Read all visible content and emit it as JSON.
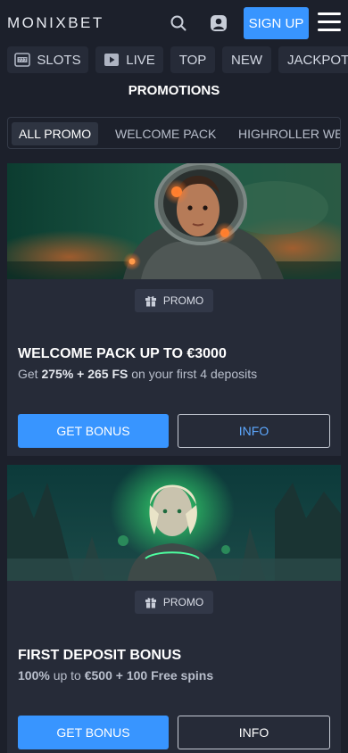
{
  "header": {
    "logo": "MONIXBET",
    "signup_label": "SIGN UP"
  },
  "nav": {
    "items": [
      {
        "label": "SLOTS",
        "icon": "slot-machine-icon"
      },
      {
        "label": "LIVE",
        "icon": "play-icon"
      },
      {
        "label": "TOP"
      },
      {
        "label": "NEW"
      },
      {
        "label": "JACKPOT"
      }
    ]
  },
  "page": {
    "title": "PROMOTIONS"
  },
  "tabs": [
    {
      "label": "ALL PROMO",
      "active": true
    },
    {
      "label": "WELCOME PACK"
    },
    {
      "label": "HIGHROLLER WE"
    }
  ],
  "promos": [
    {
      "badge": "PROMO",
      "title": "WELCOME PACK UP TO €3000",
      "desc_parts": [
        "Get ",
        "275% + 265 FS",
        " on your first 4 deposits"
      ],
      "bonus_label": "GET BONUS",
      "info_label": "INFO",
      "info_color": "#5da8ff"
    },
    {
      "badge": "PROMO",
      "title": "FIRST DEPOSIT BONUS",
      "desc_parts": [
        "100%",
        " up to ",
        "€500 + 100 Free spins"
      ],
      "bonus_label": "GET BONUS",
      "info_label": "INFO",
      "info_color": "#ffffff"
    }
  ],
  "colors": {
    "accent": "#3895ff",
    "background": "#1c202b",
    "card": "#262b38"
  }
}
